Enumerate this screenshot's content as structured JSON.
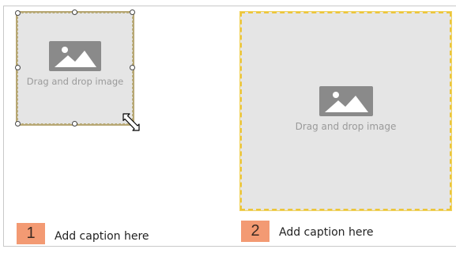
{
  "placeholders": [
    {
      "label": "Drag and drop image",
      "selected": true,
      "border_color": "#b7a774"
    },
    {
      "label": "Drag and drop image",
      "selected": false,
      "border_color": "#ecc53a"
    }
  ],
  "captions": [
    {
      "number": "1",
      "text": "Add caption here"
    },
    {
      "number": "2",
      "text": "Add caption here"
    }
  ],
  "colors": {
    "badge": "#f39a73",
    "placeholder_bg": "#e5e5e5",
    "icon": "#8a8a8a"
  },
  "icons": {
    "image": "image-icon",
    "resize_cursor": "resize-cursor-icon"
  }
}
